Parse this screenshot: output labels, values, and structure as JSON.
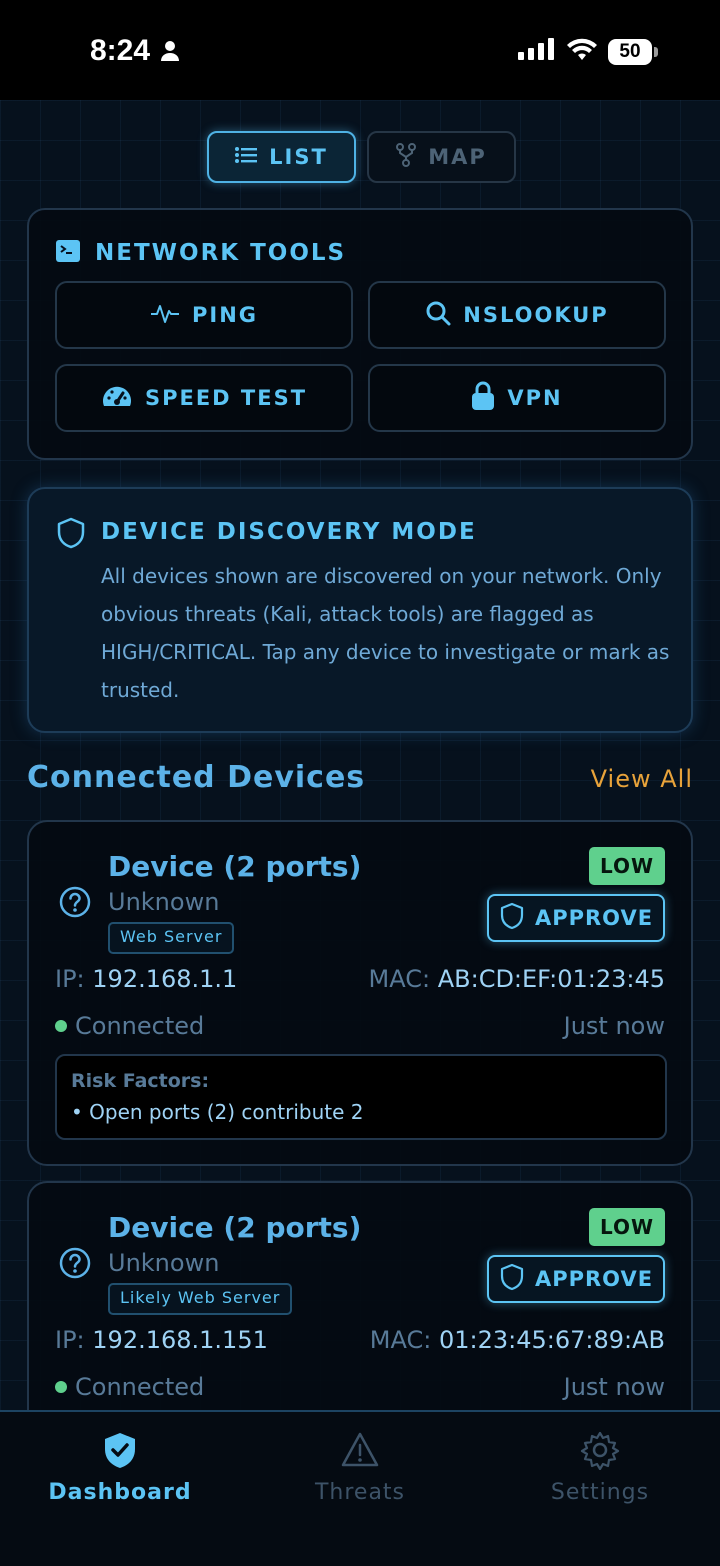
{
  "status_bar": {
    "time": "8:24",
    "battery": "50"
  },
  "view_toggle": {
    "list": "LIST",
    "map": "MAP",
    "active": "list"
  },
  "network_tools": {
    "title": "NETWORK TOOLS",
    "buttons": [
      {
        "label": "PING",
        "icon": "pulse-icon"
      },
      {
        "label": "NSLOOKUP",
        "icon": "search-icon"
      },
      {
        "label": "SPEED TEST",
        "icon": "speedometer-icon"
      },
      {
        "label": "VPN",
        "icon": "lock-icon"
      }
    ]
  },
  "discovery": {
    "title": "DEVICE DISCOVERY MODE",
    "text": "All devices shown are discovered on your network. Only obvious threats (Kali, attack tools) are flagged as HIGH/CRITICAL. Tap any device to investigate or mark as trusted."
  },
  "devices_section": {
    "title": "Connected Devices",
    "view_all": "View All"
  },
  "devices": [
    {
      "name": "Device (2 ports)",
      "vendor": "Unknown",
      "tag": "Web Server",
      "risk": "LOW",
      "approve": "APPROVE",
      "ip_label": "IP:",
      "ip": "192.168.1.1",
      "mac_label": "MAC:",
      "mac": "AB:CD:EF:01:23:45",
      "status": "Connected",
      "last_seen": "Just now",
      "risk_factors_title": "Risk Factors:",
      "risk_factors": [
        "• Open ports (2) contribute 2"
      ]
    },
    {
      "name": "Device (2 ports)",
      "vendor": "Unknown",
      "tag": "Likely Web Server",
      "risk": "LOW",
      "approve": "APPROVE",
      "ip_label": "IP:",
      "ip": "192.168.1.151",
      "mac_label": "MAC:",
      "mac": "01:23:45:67:89:AB",
      "status": "Connected",
      "last_seen": "Just now"
    }
  ],
  "tabs": [
    {
      "label": "Dashboard",
      "icon": "shield-check-icon",
      "active": true
    },
    {
      "label": "Threats",
      "icon": "warning-icon",
      "active": false
    },
    {
      "label": "Settings",
      "icon": "gear-icon",
      "active": false
    }
  ],
  "colors": {
    "accent": "#5cc4f4",
    "risk_low": "#5fd08d",
    "link": "#e8a33a",
    "background": "#06111d"
  }
}
